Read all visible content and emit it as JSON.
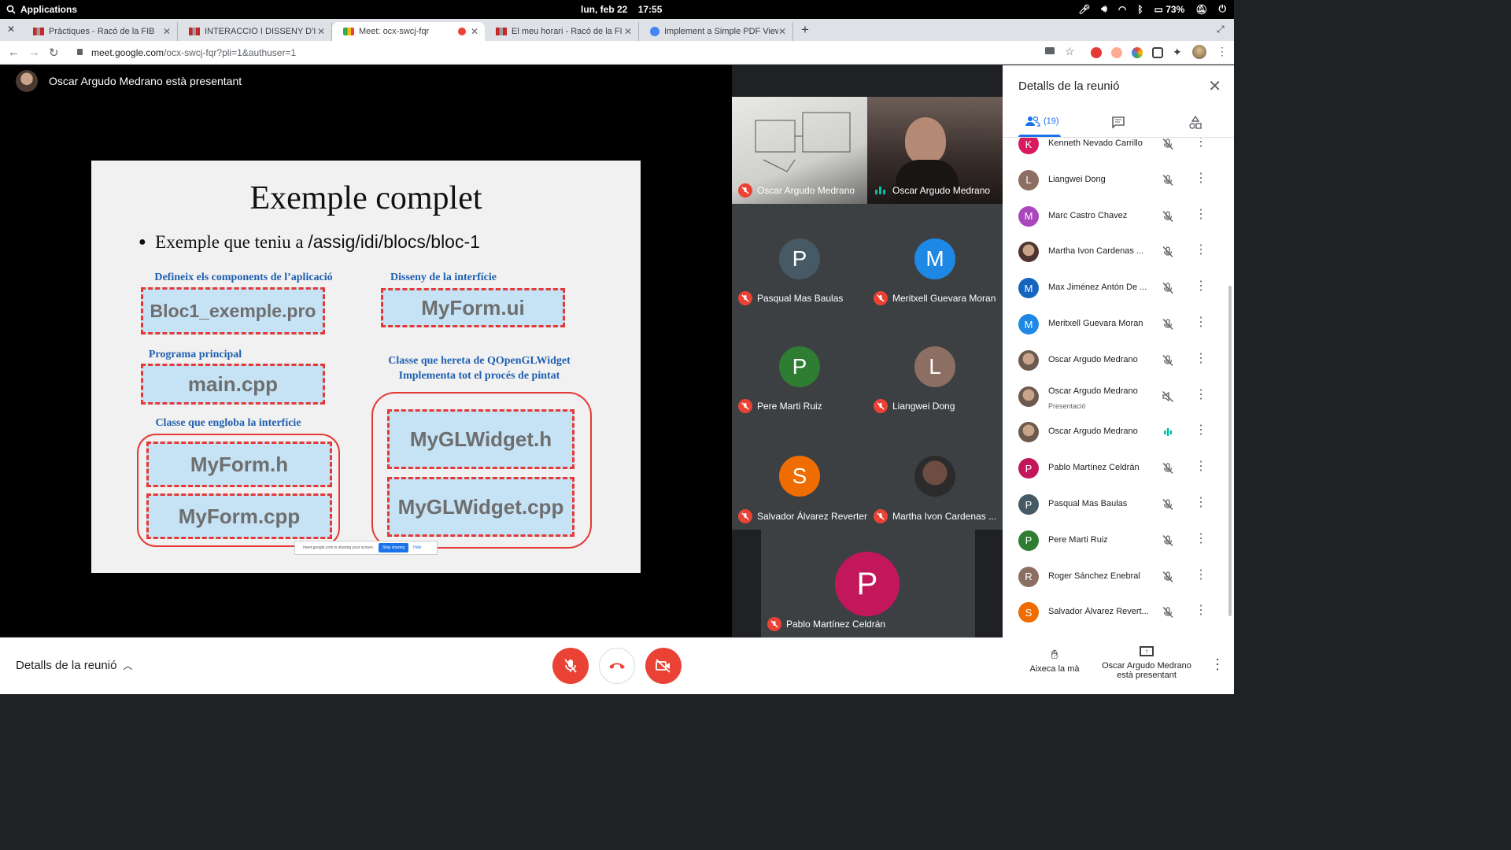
{
  "system": {
    "apps_label": "Applications",
    "clock_date": "lun, feb 22",
    "clock_time": "17:55",
    "battery": "73%"
  },
  "tabs": [
    {
      "title": "Pràctiques - Racó de la FIB"
    },
    {
      "title": "INTERACCIÓ I DISSENY D'INTER"
    },
    {
      "title": "Meet: ocx-swcj-fqr"
    },
    {
      "title": "El meu horari - Racó de la FIB"
    },
    {
      "title": "Implement a Simple PDF Viewer"
    }
  ],
  "address": {
    "domain": "meet.google.com",
    "path": "/ocx-swcj-fqr?pli=1&authuser=1"
  },
  "presenter_text": "Oscar Argudo Medrano està presentant",
  "slide": {
    "title": "Exemple complet",
    "bullet_prefix": "Exemple que teniu a ",
    "bullet_path": "/assig/idi/blocs/bloc-1",
    "cap_components": "Defineix els components de l’aplicació",
    "cap_design": "Disseny de la interfície",
    "cap_main": "Programa principal",
    "cap_class_iface": "Classe que engloba la interfície",
    "cap_glwidget_1": "Classe que hereta de QOpenGLWidget",
    "cap_glwidget_2": "Implementa tot el procés de pintat",
    "box_pro": "Bloc1_exemple.pro",
    "box_ui": "MyForm.ui",
    "box_main": "main.cpp",
    "box_formh": "MyForm.h",
    "box_formcpp": "MyForm.cpp",
    "box_glh": "MyGLWidget.h",
    "box_glcpp": "MyGLWidget.cpp",
    "share_note": "meet.google.com is sharing your screen.",
    "share_stop": "Stop sharing",
    "share_hide": "Hide"
  },
  "tiles": [
    {
      "name": "Oscar Argudo Medrano"
    },
    {
      "name": "Oscar Argudo Medrano"
    },
    {
      "name": "Pasqual Mas Baulas",
      "initial": "P",
      "color": "#455a64"
    },
    {
      "name": "Meritxell Guevara Moran",
      "initial": "M",
      "color": "#1e88e5"
    },
    {
      "name": "Pere Marti Ruiz",
      "initial": "P",
      "color": "#2e7d32"
    },
    {
      "name": "Liangwei Dong",
      "initial": "L",
      "color": "#8d6e63"
    },
    {
      "name": "Salvador Álvarez Reverter",
      "initial": "S",
      "color": "#ef6c00"
    },
    {
      "name": "Martha Ivon Cardenas ..."
    },
    {
      "name": "Pablo Martínez Celdrán",
      "initial": "P",
      "color": "#c2185b"
    }
  ],
  "panel": {
    "title": "Detalls de la reunió",
    "people_count": "(19)",
    "participants": [
      {
        "name": "Kenneth Nevado Carrillo",
        "initial": "K",
        "color": "#d81b60"
      },
      {
        "name": "Liangwei Dong",
        "initial": "L",
        "color": "#8d6e63"
      },
      {
        "name": "Marc Castro Chavez",
        "initial": "M",
        "color": "#ab47bc"
      },
      {
        "name": "Martha Ivon Cardenas ...",
        "initial": "",
        "color": "#4e342e"
      },
      {
        "name": "Max Jiménez Antón De ...",
        "initial": "M",
        "color": "#1565c0"
      },
      {
        "name": "Meritxell Guevara Moran",
        "initial": "M",
        "color": "#1e88e5"
      },
      {
        "name": "Oscar Argudo Medrano",
        "initial": "",
        "color": "#6d5a4e"
      },
      {
        "name": "Oscar Argudo Medrano",
        "sub": "Presentació",
        "initial": "",
        "color": "#6d5a4e"
      },
      {
        "name": "Oscar Argudo Medrano",
        "initial": "",
        "color": "#6d5a4e"
      },
      {
        "name": "Pablo Martínez Celdrán",
        "initial": "P",
        "color": "#c2185b"
      },
      {
        "name": "Pasqual Mas Baulas",
        "initial": "P",
        "color": "#455a64"
      },
      {
        "name": "Pere Marti Ruiz",
        "initial": "P",
        "color": "#2e7d32"
      },
      {
        "name": "Roger Sánchez Enebral",
        "initial": "R",
        "color": "#8d6e63"
      },
      {
        "name": "Salvador Álvarez Revert...",
        "initial": "S",
        "color": "#ef6c00"
      }
    ]
  },
  "bottom": {
    "details_label": "Detalls de la reunió",
    "raise_hand": "Aixeca la mà",
    "presenting_1": "Oscar Argudo Medrano",
    "presenting_2": "està presentant"
  },
  "colors": {
    "accent": "#1a73e8",
    "danger": "#ea4335",
    "speaking": "#00bfa5"
  }
}
